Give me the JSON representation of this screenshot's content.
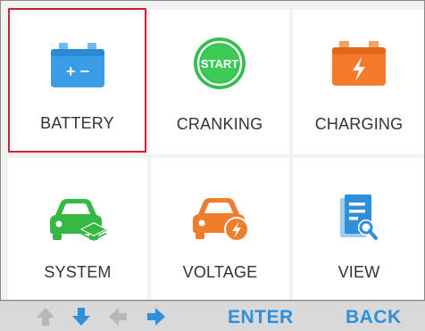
{
  "tiles": [
    {
      "label": "BATTERY",
      "icon": "battery-icon",
      "selected": true
    },
    {
      "label": "CRANKING",
      "icon": "start-button-icon",
      "selected": false
    },
    {
      "label": "CHARGING",
      "icon": "charging-battery-icon",
      "selected": false
    },
    {
      "label": "SYSTEM",
      "icon": "car-system-icon",
      "selected": false
    },
    {
      "label": "VOLTAGE",
      "icon": "car-voltage-icon",
      "selected": false
    },
    {
      "label": "VIEW",
      "icon": "view-document-icon",
      "selected": false
    }
  ],
  "start_badge_text": "START",
  "battery_terminals_text": "+ −",
  "bottom_bar": {
    "arrows": [
      {
        "icon": "arrow-up-icon",
        "enabled": false
      },
      {
        "icon": "arrow-down-icon",
        "enabled": true
      },
      {
        "icon": "arrow-left-icon",
        "enabled": false
      },
      {
        "icon": "arrow-right-icon",
        "enabled": true
      }
    ],
    "enter_label": "ENTER",
    "back_label": "BACK"
  },
  "colors": {
    "battery_blue": "#3a9ee6",
    "start_green": "#2fbf4a",
    "charging_orange": "#f37b2a",
    "system_green": "#35b944",
    "voltage_orange": "#f07d2c",
    "view_blue": "#2f8fd8",
    "selection_red": "#d01e36",
    "arrow_enabled": "#2f8fd8",
    "arrow_disabled": "#b7b7b7"
  }
}
